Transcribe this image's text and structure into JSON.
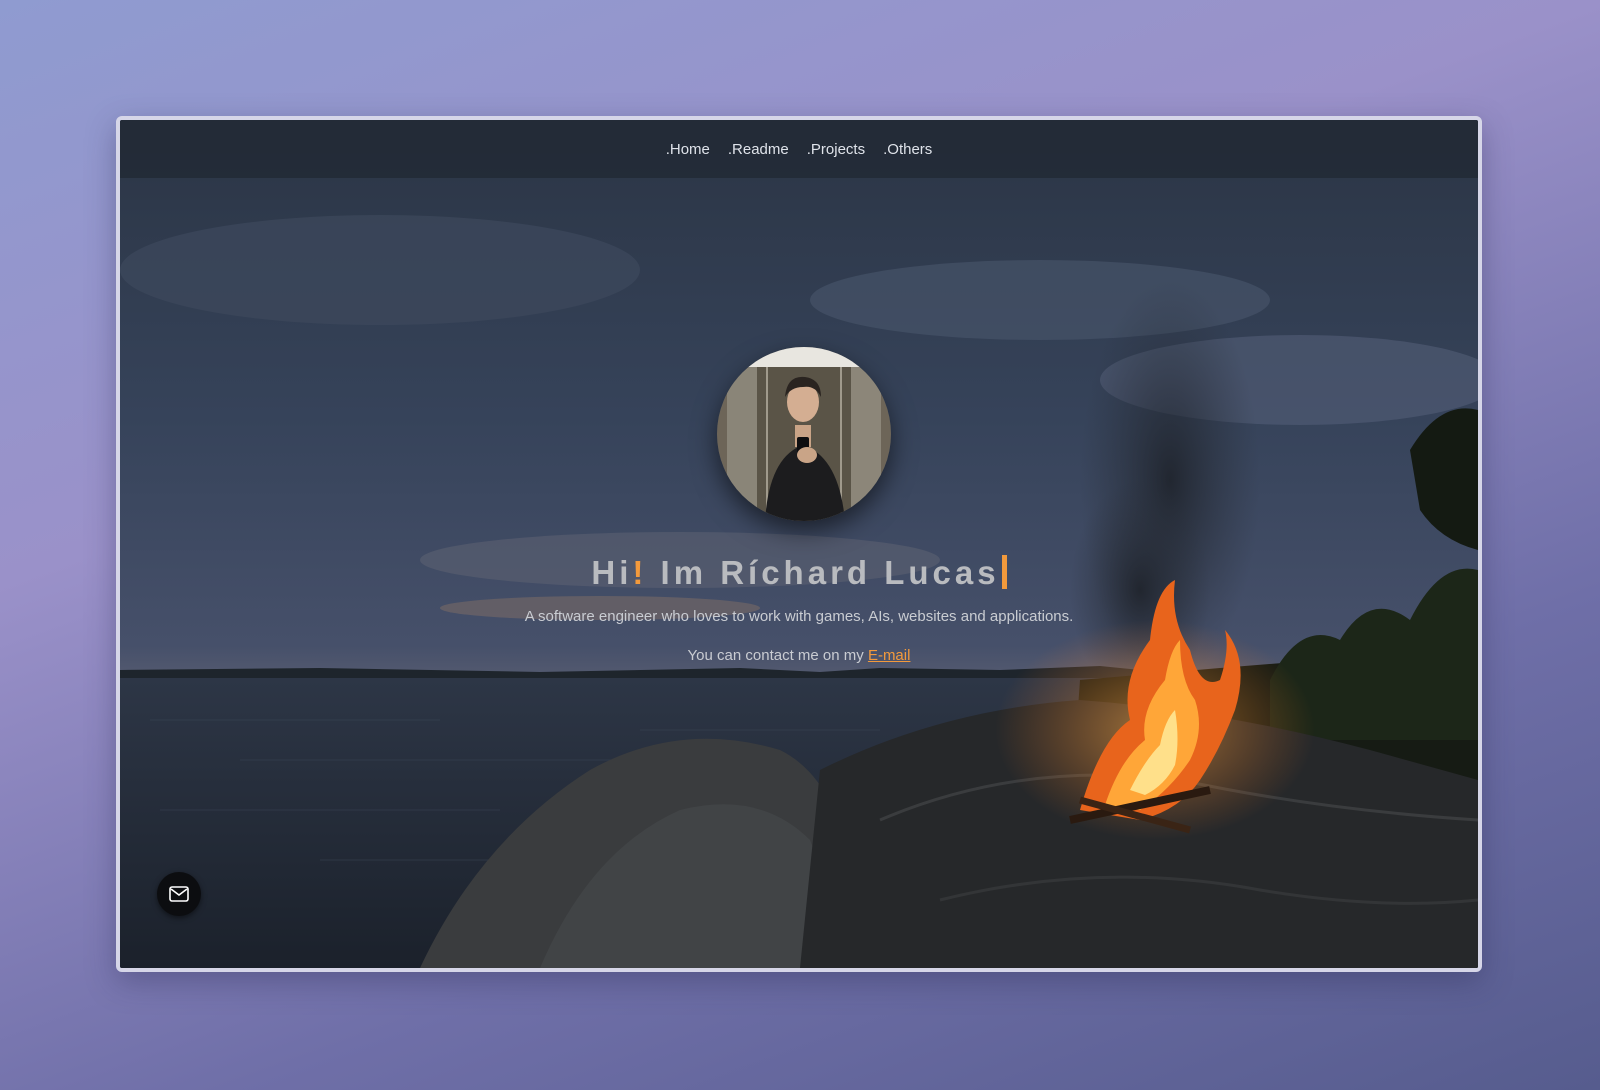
{
  "nav": {
    "items": [
      {
        "label": ".Home"
      },
      {
        "label": ".Readme"
      },
      {
        "label": ".Projects"
      },
      {
        "label": ".Others"
      }
    ]
  },
  "hero": {
    "greeting_start": "Hi",
    "greeting_bang": "!",
    "greeting_rest": " Im Ríchard Lucas",
    "subtitle": "A software engineer who loves to work with games, AIs, websites and applications.",
    "contact_prefix": "You can contact me on my ",
    "contact_link": "E-mail"
  },
  "icons": {
    "mail_fab": "mail-icon"
  },
  "colors": {
    "accent": "#f39a3c",
    "navbar": "#222a36"
  }
}
